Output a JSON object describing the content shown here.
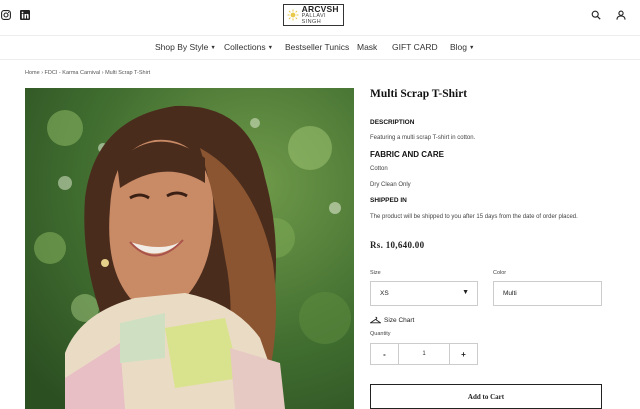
{
  "header": {
    "logo_line1": "ARCVSH",
    "logo_line2": "PALLAVI SINGH",
    "social": [
      "instagram-icon",
      "linkedin-icon"
    ],
    "icons": [
      "search-icon",
      "user-icon"
    ]
  },
  "nav": {
    "items": [
      {
        "label": "Shop By Style",
        "dropdown": true
      },
      {
        "label": "Collections",
        "dropdown": true
      },
      {
        "label": "Bestseller Tunics",
        "dropdown": false
      },
      {
        "label": "Mask",
        "dropdown": false
      },
      {
        "label": "GIFT CARD",
        "dropdown": false
      },
      {
        "label": "Blog",
        "dropdown": true
      }
    ],
    "caret": "▼"
  },
  "breadcrumb": "Home › FDCI - Karma Carnival › Multi Scrap T-Shirt",
  "product": {
    "title": "Multi Scrap T-Shirt",
    "description_heading": "DESCRIPTION",
    "description": "Featuring a multi scrap T-shirt in cotton.",
    "fabric_heading": "FABRIC AND CARE",
    "fabric": "Cotton",
    "care": "Dry Clean Only",
    "shipping_heading": "SHIPPED IN",
    "shipping": "The product will be shipped to you after 15 days from the date of order placed.",
    "price": "Rs. 10,640.00",
    "size_label": "Size",
    "size_value": "XS",
    "size_caret": "▼",
    "color_label": "Color",
    "color_value": "Multi",
    "size_chart": "Size Chart",
    "quantity_label": "Quantity",
    "qty_minus": "-",
    "qty_value": "1",
    "qty_plus": "+",
    "add_to_cart": "Add to Cart"
  },
  "colors": {
    "text": "#222222",
    "border": "#cccccc",
    "foliage": "#3d6b2e",
    "logo_accent": "#e8c94a"
  }
}
